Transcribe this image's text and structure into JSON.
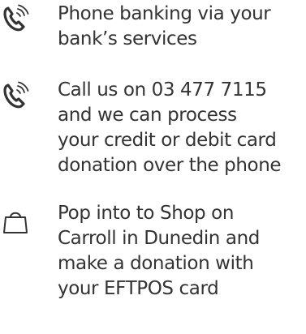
{
  "items": [
    {
      "icon": "phone-icon",
      "lines": [
        "Phone banking via your",
        "bank’s services"
      ]
    },
    {
      "icon": "phone-icon",
      "lines": [
        "Call us on 03 477 7115",
        "and we can process",
        "your credit or debit card",
        "donation over the phone"
      ]
    },
    {
      "icon": "shopping-bag-icon",
      "lines": [
        "Pop into to Shop on",
        "Carroll in Dunedin and",
        "make a donation with",
        "your EFTPOS card"
      ]
    }
  ],
  "colors": {
    "text": "#333333",
    "icon": "#333333"
  }
}
